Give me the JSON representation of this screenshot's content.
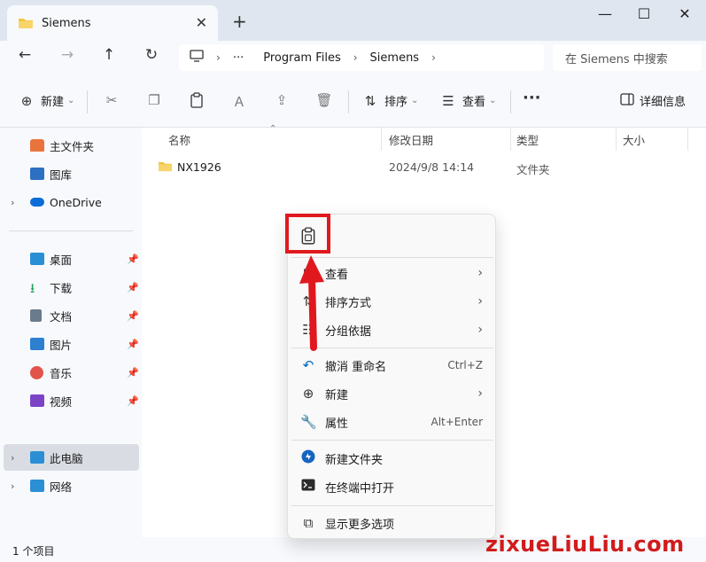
{
  "window": {
    "tab_title": "Siemens",
    "tab_close": "✕",
    "new_tab": "+",
    "minimize": "—",
    "maximize": "☐",
    "close": "✕"
  },
  "nav": {
    "back": "←",
    "forward": "→",
    "up": "↑",
    "refresh": "↻",
    "address_more": "···",
    "breadcrumb": [
      "Program Files",
      "Siemens"
    ],
    "search_placeholder": "在 Siemens 中搜索"
  },
  "toolbar": {
    "new_label": "新建",
    "sort_label": "排序",
    "view_label": "查看",
    "more_label": "···",
    "details_label": "详细信息"
  },
  "sidebar": {
    "items": [
      {
        "label": "主文件夹",
        "icon": "home-icon",
        "color": "#e8743b"
      },
      {
        "label": "图库",
        "icon": "gallery-icon",
        "color": "#2d6fc2"
      },
      {
        "label": "OneDrive",
        "icon": "cloud-icon",
        "color": "#0a6cd6"
      },
      {
        "label": "桌面",
        "icon": "desktop-icon",
        "color": "#2b8fd6"
      },
      {
        "label": "下载",
        "icon": "download-icon",
        "color": "#1e9e5a"
      },
      {
        "label": "文档",
        "icon": "document-icon",
        "color": "#6a7b8c"
      },
      {
        "label": "图片",
        "icon": "pictures-icon",
        "color": "#2d7fd0"
      },
      {
        "label": "音乐",
        "icon": "music-icon",
        "color": "#e2534a"
      },
      {
        "label": "视频",
        "icon": "video-icon",
        "color": "#7b44c7"
      },
      {
        "label": "此电脑",
        "icon": "computer-icon",
        "color": "#2b8fd6"
      },
      {
        "label": "网络",
        "icon": "network-icon",
        "color": "#2b8fd6"
      }
    ]
  },
  "columns": {
    "name": "名称",
    "modified": "修改日期",
    "type": "类型",
    "size": "大小"
  },
  "files": [
    {
      "name": "NX1926",
      "modified": "2024/9/8 14:14",
      "type": "文件夹",
      "size": ""
    }
  ],
  "status": {
    "count": "1 个项目"
  },
  "context_menu": {
    "view": "查看",
    "sort_by": "排序方式",
    "group_by": "分组依据",
    "undo_rename": "撤消 重命名",
    "undo_shortcut": "Ctrl+Z",
    "new": "新建",
    "properties": "属性",
    "properties_shortcut": "Alt+Enter",
    "new_folder": "新建文件夹",
    "open_terminal": "在终端中打开",
    "show_more": "显示更多选项"
  },
  "watermark": "zixueLiuLiu.com",
  "colors": {
    "accent": "#0067c0",
    "highlight": "#e0191f",
    "folder": "#f4c542"
  }
}
